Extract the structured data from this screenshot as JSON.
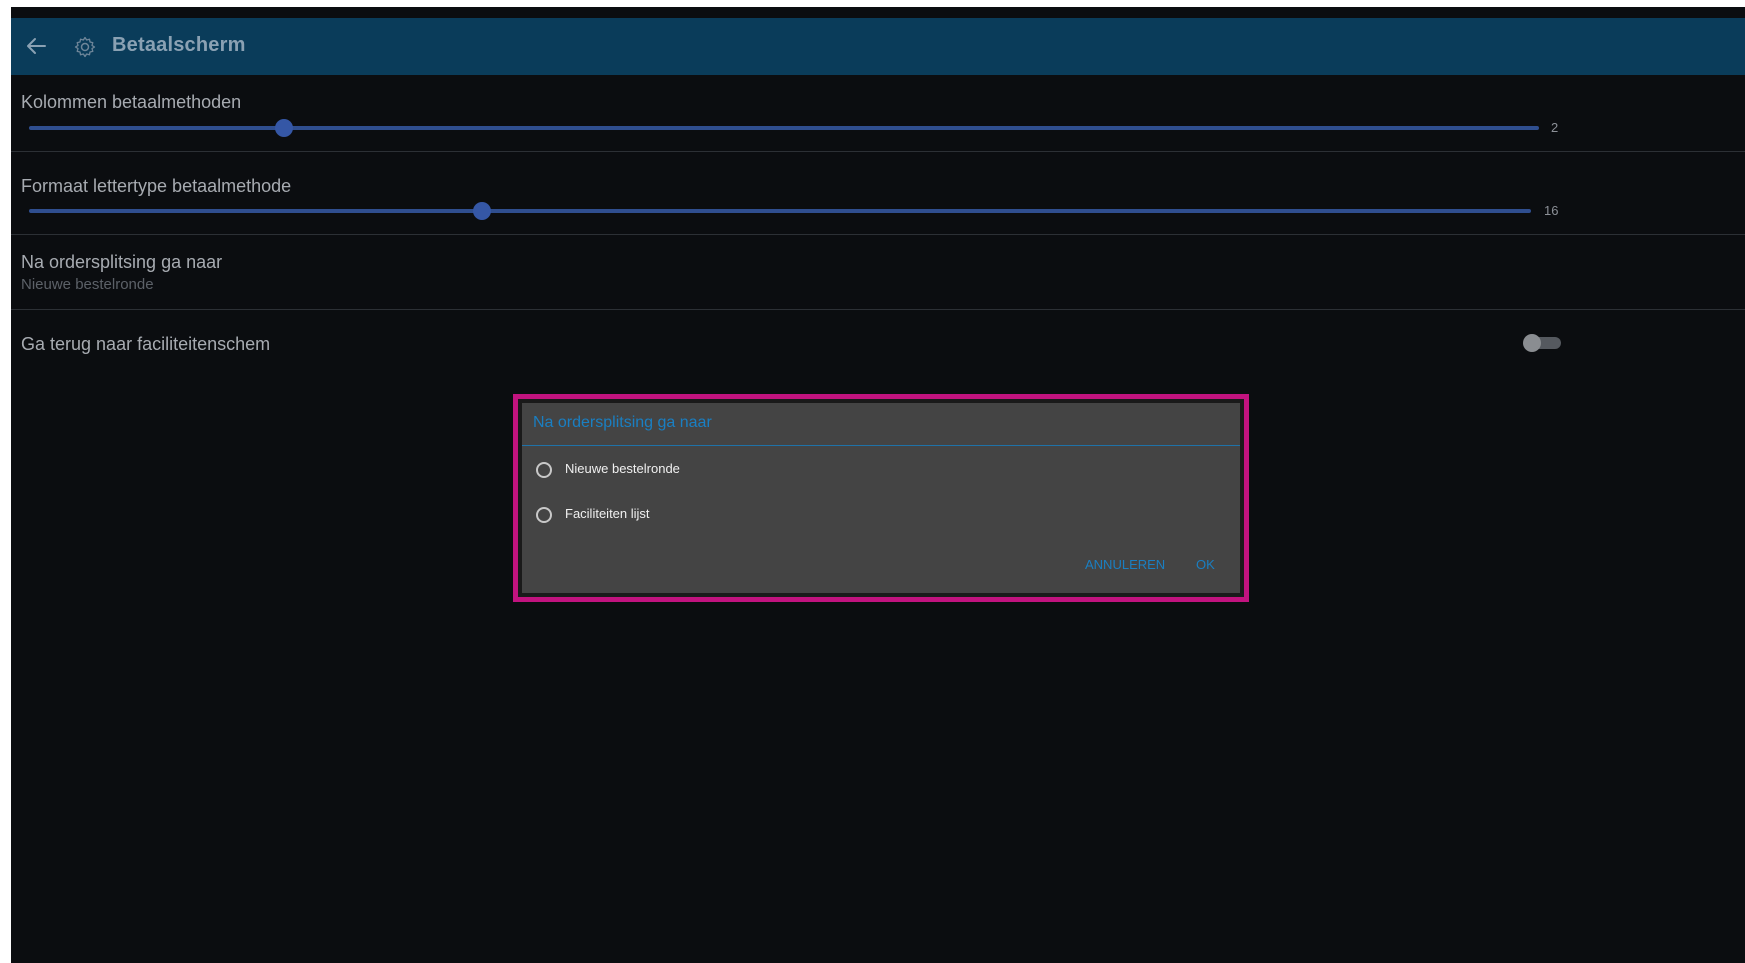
{
  "appbar": {
    "title": "Betaalscherm",
    "back_icon": "arrow-left-icon",
    "settings_icon": "gear-icon",
    "background": "#0a3c5a"
  },
  "settings": {
    "columns": {
      "label": "Kolommen betaalmethoden",
      "value": "2",
      "level": 0.17
    },
    "font_size": {
      "label": "Formaat lettertype betaalmethode",
      "value": "16",
      "level": 0.3
    },
    "after_split": {
      "label": "Na ordersplitsing ga naar",
      "current": "Nieuwe bestelronde"
    },
    "back_to_facilities": {
      "label": "Ga terug naar faciliteitenschem",
      "enabled": false
    }
  },
  "dialog": {
    "title": "Na ordersplitsing ga naar",
    "options": [
      {
        "label": "Nieuwe bestelronde",
        "selected": false
      },
      {
        "label": "Faciliteiten lijst",
        "selected": false
      }
    ],
    "cancel_label": "ANNULEREN",
    "ok_label": "OK",
    "highlight_color": "#c2137f",
    "accent_color": "#1a7fc2"
  }
}
